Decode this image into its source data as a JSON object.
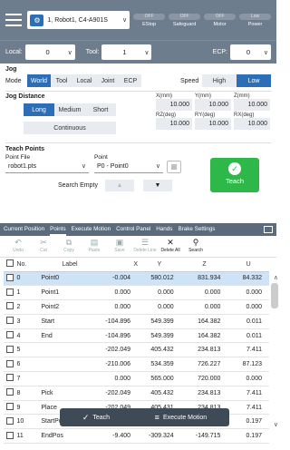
{
  "header": {
    "robot_icon": "robot-arm-icon",
    "robot_label": "1, Robot1, C4-A901S",
    "status": [
      {
        "pill": "OFF",
        "label": "EStop"
      },
      {
        "pill": "OFF",
        "label": "Safeguard"
      },
      {
        "pill": "OFF",
        "label": "Motor"
      },
      {
        "pill": "Low",
        "label": "Power"
      }
    ]
  },
  "coords": {
    "local_label": "Local:",
    "local_value": "0",
    "tool_label": "Tool:",
    "tool_value": "1",
    "ecp_label": "ECP:",
    "ecp_value": "0"
  },
  "jog": {
    "title": "Jog",
    "mode_label": "Mode",
    "modes": [
      "World",
      "Tool",
      "Local",
      "Joint",
      "ECP"
    ],
    "speed_label": "Speed",
    "speeds": [
      "High",
      "Low"
    ]
  },
  "jog_distance": {
    "title": "Jog Distance",
    "options": [
      "Long",
      "Medium",
      "Short"
    ],
    "continuous": "Continuous",
    "labels": [
      "X(mm)",
      "Y(mm)",
      "Z(mm)",
      "RZ(deg)",
      "RY(deg)",
      "RX(deg)"
    ],
    "values": [
      "10.000",
      "10.000",
      "10.000",
      "10.000",
      "10.000",
      "10.000"
    ]
  },
  "teach_points": {
    "title": "Teach Points",
    "file_label": "Point File",
    "file_value": "robot1.pts",
    "point_label": "Point",
    "point_value": "P0 - Point0",
    "search_empty": "Search Empty",
    "teach_label": "Teach"
  },
  "tabs": [
    "Current Position",
    "Points",
    "Execute Motion",
    "Control Panel",
    "Hands",
    "Brake Settings"
  ],
  "toolbar": [
    {
      "icon": "undo-icon",
      "label": "Undo"
    },
    {
      "icon": "cut-icon",
      "label": "Cut"
    },
    {
      "icon": "copy-icon",
      "label": "Copy"
    },
    {
      "icon": "paste-icon",
      "label": "Paste"
    },
    {
      "icon": "save-icon",
      "label": "Save"
    },
    {
      "icon": "delete-line-icon",
      "label": "Delete Line"
    },
    {
      "icon": "delete-all-icon",
      "label": "Delete All"
    },
    {
      "icon": "search-icon",
      "label": "Search"
    }
  ],
  "table": {
    "headers": [
      "No.",
      "Label",
      "X",
      "Y",
      "Z",
      "U"
    ],
    "rows": [
      [
        "0",
        "Point0",
        "-0.004",
        "580.012",
        "831.934",
        "84.332"
      ],
      [
        "1",
        "Point1",
        "0.000",
        "0.000",
        "0.000",
        "0.000"
      ],
      [
        "2",
        "Point2",
        "0.000",
        "0.000",
        "0.000",
        "0.000"
      ],
      [
        "3",
        "Start",
        "-104.896",
        "549.399",
        "164.382",
        "0.011"
      ],
      [
        "4",
        "End",
        "-104.896",
        "549.399",
        "164.382",
        "0.011"
      ],
      [
        "5",
        "",
        "-202.049",
        "405.432",
        "234.813",
        "7.411"
      ],
      [
        "6",
        "",
        "-210.006",
        "534.359",
        "726.227",
        "87.123"
      ],
      [
        "7",
        "",
        "0.000",
        "565.000",
        "720.000",
        "0.000"
      ],
      [
        "8",
        "Pick",
        "-202.049",
        "405.432",
        "234.813",
        "7.411"
      ],
      [
        "9",
        "Place",
        "-202.049",
        "405.431",
        "234.813",
        "7.411"
      ],
      [
        "10",
        "StartPos",
        "",
        "",
        "257",
        "0.197"
      ],
      [
        "11",
        "EndPos",
        "-9.400",
        "-309.324",
        "-149.715",
        "0.197"
      ]
    ]
  },
  "float_bar": {
    "teach": "Teach",
    "execute": "Execute Motion"
  }
}
